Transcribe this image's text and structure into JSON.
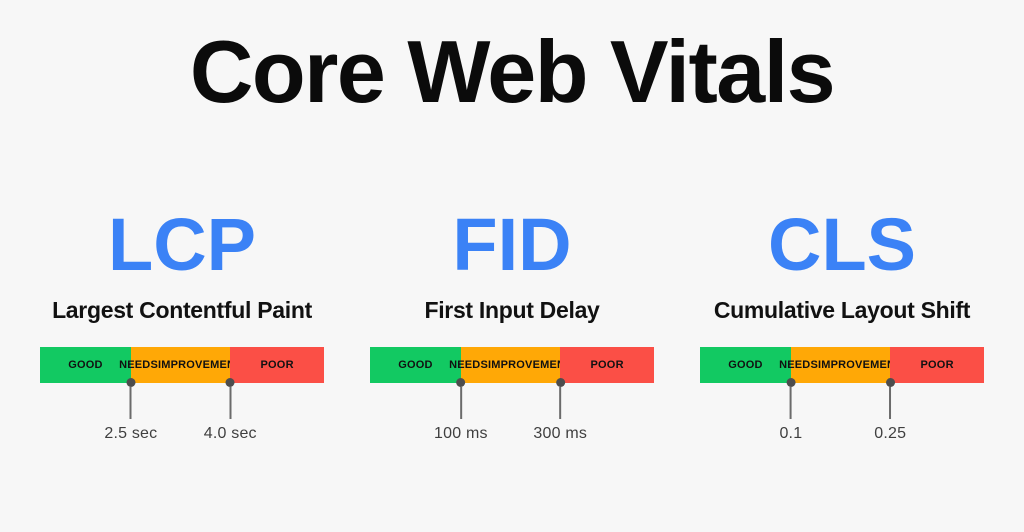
{
  "header": {
    "title": "Core Web Vitals"
  },
  "colors": {
    "background": "#f7f7f7",
    "accent_blue": "#3b82f6",
    "good_green": "#12c962",
    "needs_improvement_orange": "#ffa806",
    "poor_red": "#fb4f46",
    "marker_gray": "#4d4d4d",
    "title_black": "#0b0b0b"
  },
  "metrics": [
    {
      "acronym": "LCP",
      "name": "Largest Contentful Paint",
      "segments": [
        {
          "label_line1": "GOOD",
          "label_line2": "",
          "width_pct": 32
        },
        {
          "label_line1": "NEEDS",
          "label_line2": "IMPROVEMENT",
          "width_pct": 35
        },
        {
          "label_line1": "POOR",
          "label_line2": "",
          "width_pct": 33
        }
      ],
      "thresholds": [
        {
          "value": "2.5 sec",
          "position_pct": 32
        },
        {
          "value": "4.0 sec",
          "position_pct": 67
        }
      ]
    },
    {
      "acronym": "FID",
      "name": "First Input Delay",
      "segments": [
        {
          "label_line1": "GOOD",
          "label_line2": "",
          "width_pct": 32
        },
        {
          "label_line1": "NEEDS",
          "label_line2": "IMPROVEMENT",
          "width_pct": 35
        },
        {
          "label_line1": "POOR",
          "label_line2": "",
          "width_pct": 33
        }
      ],
      "thresholds": [
        {
          "value": "100 ms",
          "position_pct": 32
        },
        {
          "value": "300 ms",
          "position_pct": 67
        }
      ]
    },
    {
      "acronym": "CLS",
      "name": "Cumulative Layout Shift",
      "segments": [
        {
          "label_line1": "GOOD",
          "label_line2": "",
          "width_pct": 32
        },
        {
          "label_line1": "NEEDS",
          "label_line2": "IMPROVEMENT",
          "width_pct": 35
        },
        {
          "label_line1": "POOR",
          "label_line2": "",
          "width_pct": 33
        }
      ],
      "thresholds": [
        {
          "value": "0.1",
          "position_pct": 32
        },
        {
          "value": "0.25",
          "position_pct": 67
        }
      ]
    }
  ]
}
